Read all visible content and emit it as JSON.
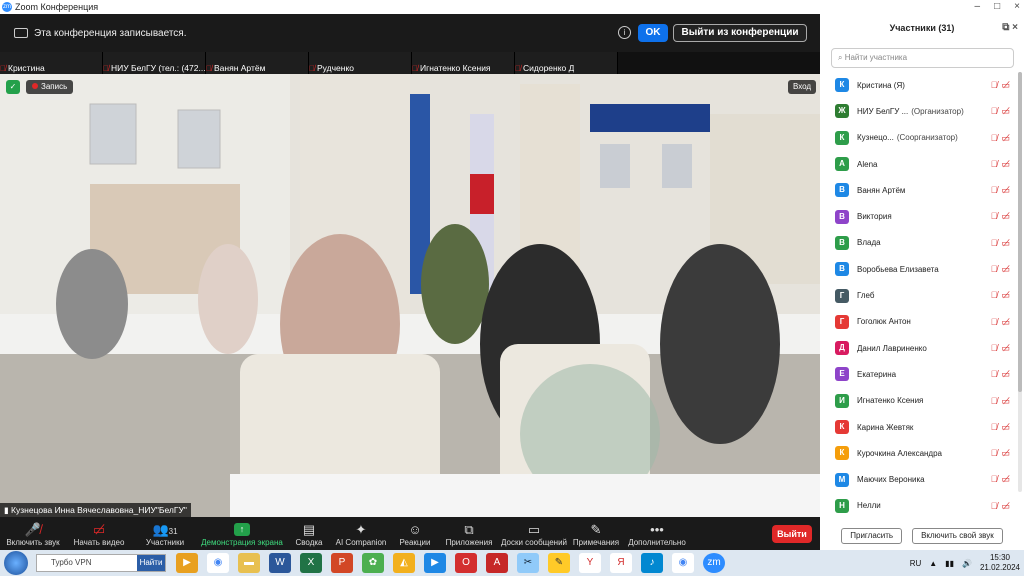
{
  "window": {
    "title": "Zoom Конференция"
  },
  "recording_banner": {
    "text": "Эта конференция записывается.",
    "ok_label": "OK",
    "leave_label": "Выйти из конференции"
  },
  "thumbnails": [
    {
      "name": "Кристина"
    },
    {
      "name": "НИУ БелГУ (тел.: (472..."
    },
    {
      "name": "Ванян Артём"
    },
    {
      "name": "Рудченко"
    },
    {
      "name": "Игнатенко Ксения"
    },
    {
      "name": "Сидоренко Д"
    }
  ],
  "video": {
    "record_label": "Запись",
    "view_label": "Вход",
    "active_speaker": "Кузнецова Инна Вячеславовна_НИУ\"БелГУ\""
  },
  "toolbar": {
    "unmute": "Включить звук",
    "start_video": "Начать видео",
    "participants": "Участники",
    "participants_count": "31",
    "share_screen": "Демонстрация экрана",
    "summary": "Сводка",
    "ai_companion": "AI Companion",
    "reactions": "Реакции",
    "apps": "Приложения",
    "whiteboards": "Доски сообщений",
    "notes": "Примечания",
    "more": "Дополнительно",
    "leave": "Выйти"
  },
  "panel": {
    "title": "Участники (31)",
    "search_placeholder": "Найти участника",
    "invite": "Пригласить",
    "unmute_me": "Включить свой звук",
    "participants": [
      {
        "initial": "К",
        "name": "Кристина (Я)",
        "role": "",
        "color": "#1e88e5"
      },
      {
        "initial": "Ж",
        "name": "НИУ БелГУ ...",
        "role": "(Организатор)",
        "color": "#2e7d32"
      },
      {
        "initial": "К",
        "name": "Кузнецо...",
        "role": "(Соорганизатор)",
        "color": "#2e9d4a"
      },
      {
        "initial": "A",
        "name": "Alena",
        "role": "",
        "color": "#2e9d4a"
      },
      {
        "initial": "В",
        "name": "Ванян Артём",
        "role": "",
        "color": "#1e88e5"
      },
      {
        "initial": "В",
        "name": "Виктория",
        "role": "",
        "color": "#8e44c9"
      },
      {
        "initial": "В",
        "name": "Влада",
        "role": "",
        "color": "#2e9d4a"
      },
      {
        "initial": "В",
        "name": "Воробьева Елизавета",
        "role": "",
        "color": "#1e88e5"
      },
      {
        "initial": "Г",
        "name": "Глеб",
        "role": "",
        "color": "#455a64"
      },
      {
        "initial": "Г",
        "name": "Гоголюк Антон",
        "role": "",
        "color": "#e53935"
      },
      {
        "initial": "Д",
        "name": "Данил Лавриненко",
        "role": "",
        "color": "#d81b60"
      },
      {
        "initial": "Е",
        "name": "Екатерина",
        "role": "",
        "color": "#8e44c9"
      },
      {
        "initial": "И",
        "name": "Игнатенко Ксения",
        "role": "",
        "color": "#2e9d4a"
      },
      {
        "initial": "К",
        "name": "Карина Жевтяк",
        "role": "",
        "color": "#e53935"
      },
      {
        "initial": "К",
        "name": "Курочкина Александра",
        "role": "",
        "color": "#f59e0b"
      },
      {
        "initial": "М",
        "name": "Маючих Вероника",
        "role": "",
        "color": "#1e88e5"
      },
      {
        "initial": "Н",
        "name": "Нелли",
        "role": "",
        "color": "#2e9d4a"
      }
    ]
  },
  "taskbar": {
    "search_text": "Турбо VPN",
    "search_button": "Найти",
    "lang": "RU",
    "time": "15:30",
    "date": "21.02.2024"
  }
}
